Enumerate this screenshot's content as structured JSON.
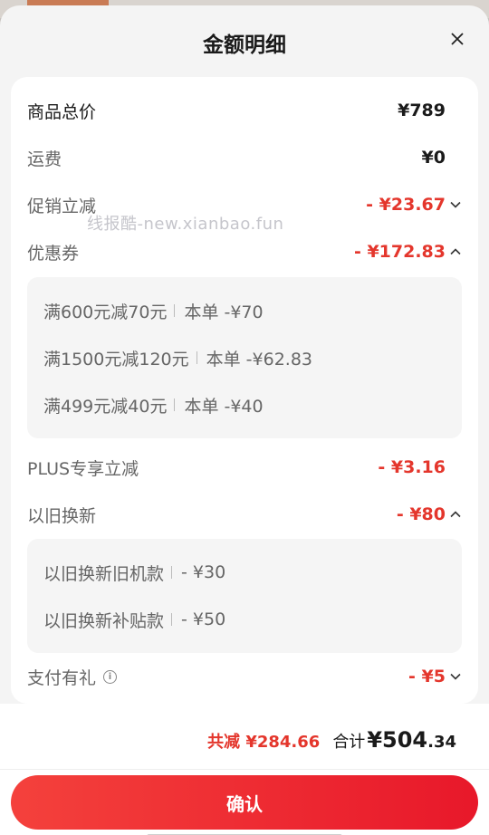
{
  "header": {
    "title": "金额明细"
  },
  "rows": {
    "goods_total": {
      "label": "商品总价",
      "value": "¥789"
    },
    "shipping": {
      "label": "运费",
      "value": "¥0"
    },
    "promo": {
      "label": "促销立减",
      "value": "- ¥23.67"
    },
    "coupon": {
      "label": "优惠券",
      "value": "- ¥172.83"
    },
    "plus": {
      "label": "PLUS专享立减",
      "value": "- ¥3.16"
    },
    "trade_in": {
      "label": "以旧换新",
      "value": "- ¥80"
    },
    "pay_gift": {
      "label": "支付有礼",
      "value": "- ¥5"
    }
  },
  "coupon_items": [
    {
      "name": "满600元减70元",
      "detail": "本单 -¥70"
    },
    {
      "name": "满1500元减120元",
      "detail": "本单 -¥62.83"
    },
    {
      "name": "满499元减40元",
      "detail": "本单 -¥40"
    }
  ],
  "trade_in_items": [
    {
      "name": "以旧换新旧机款",
      "detail": "- ¥30"
    },
    {
      "name": "以旧换新补贴款",
      "detail": "- ¥50"
    }
  ],
  "watermark": "线报酷-new.xianbao.fun",
  "footer": {
    "discount": "共减 ¥284.66",
    "sum_label": "合计",
    "sum_int": "¥504",
    "sum_dec": ".34",
    "confirm_label": "确认"
  },
  "colors": {
    "accent": "#e4362c",
    "button_start": "#f4413c",
    "button_end": "#e8182a"
  }
}
